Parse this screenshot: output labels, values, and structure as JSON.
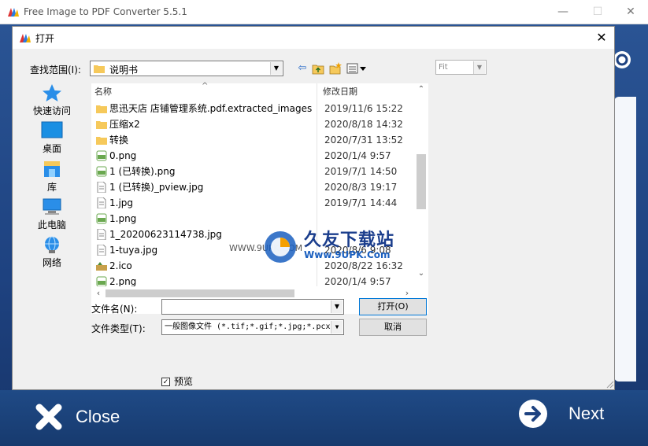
{
  "app": {
    "title": "Free Image to PDF Converter 5.5.1",
    "window_controls": {
      "minimize": "—",
      "maximize": "☐",
      "close": "✕"
    },
    "close_label": "Close",
    "next_label": "Next"
  },
  "dialog": {
    "title": "打开",
    "close_glyph": "✕",
    "look_in_label": "查找范围(I):",
    "look_in_value": "说明书",
    "zoom_value": "Fit",
    "places": [
      {
        "label": "快速访问",
        "icon": "star-icon"
      },
      {
        "label": "桌面",
        "icon": "desktop-icon"
      },
      {
        "label": "库",
        "icon": "library-icon"
      },
      {
        "label": "此电脑",
        "icon": "computer-icon"
      },
      {
        "label": "网络",
        "icon": "network-icon"
      }
    ],
    "columns": {
      "name": "名称",
      "date": "修改日期",
      "sort_caret": "^"
    },
    "files": [
      {
        "name": "思迅天店 店铺管理系统.pdf.extracted_images",
        "date": "2019/11/6 15:22",
        "type": "folder"
      },
      {
        "name": "压缩x2",
        "date": "2020/8/18 14:32",
        "type": "folder"
      },
      {
        "name": "转换",
        "date": "2020/7/31 13:52",
        "type": "folder"
      },
      {
        "name": "0.png",
        "date": "2020/1/4 9:57",
        "type": "png"
      },
      {
        "name": "1 (已转换).png",
        "date": "2019/7/1 14:50",
        "type": "png"
      },
      {
        "name": "1 (已转换)_pview.jpg",
        "date": "2020/8/3 19:17",
        "type": "jpg"
      },
      {
        "name": "1.jpg",
        "date": "2019/7/1 14:44",
        "type": "jpg"
      },
      {
        "name": "1.png",
        "date": "",
        "type": "png"
      },
      {
        "name": "1_20200623114738.jpg",
        "date": "",
        "type": "jpg"
      },
      {
        "name": "1-tuya.jpg",
        "date": "2020/8/6 9:08",
        "type": "jpg"
      },
      {
        "name": "2.ico",
        "date": "2020/8/22 16:32",
        "type": "ico"
      },
      {
        "name": "2.png",
        "date": "2020/1/4 9:57",
        "type": "png"
      }
    ],
    "filename_label": "文件名(N):",
    "filename_value": "",
    "filetype_label": "文件类型(T):",
    "filetype_value": "一般图像文件 (*.tif;*.gif;*.jpg;*.pcx",
    "open_button": "打开(O)",
    "cancel_button": "取消",
    "preview_label": "预览",
    "preview_checked": "✓"
  },
  "watermark": {
    "small_text": "WWW.9UPK.COM",
    "brand_text": "久友下载站",
    "url_text": "Www.9UPK.Com"
  }
}
